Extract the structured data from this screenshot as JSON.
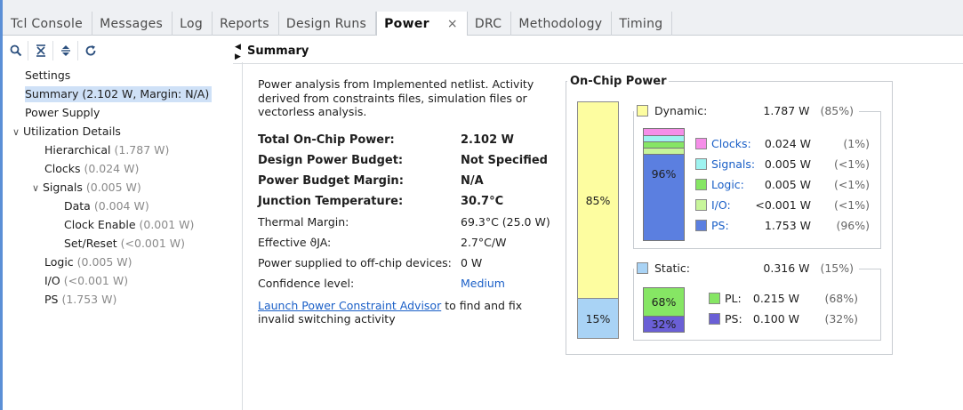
{
  "tabs": [
    {
      "label": "Tcl Console"
    },
    {
      "label": "Messages"
    },
    {
      "label": "Log"
    },
    {
      "label": "Reports"
    },
    {
      "label": "Design Runs"
    },
    {
      "label": "Power",
      "close": "×"
    },
    {
      "label": "DRC"
    },
    {
      "label": "Methodology"
    },
    {
      "label": "Timing"
    }
  ],
  "toolbar": {
    "icons": [
      "search-icon",
      "collapse-all-icon",
      "expand-all-icon",
      "refresh-icon"
    ]
  },
  "tree": {
    "settings": "Settings",
    "summary": "Summary (2.102 W, Margin: N/A)",
    "power_supply": "Power Supply",
    "utilization": "Utilization Details",
    "hierarchical": {
      "label": "Hierarchical",
      "value": "(1.787 W)"
    },
    "clocks": {
      "label": "Clocks",
      "value": "(0.024 W)"
    },
    "signals": {
      "label": "Signals",
      "value": "(0.005 W)"
    },
    "data": {
      "label": "Data",
      "value": "(0.004 W)"
    },
    "clock_enable": {
      "label": "Clock Enable",
      "value": "(0.001 W)"
    },
    "set_reset": {
      "label": "Set/Reset",
      "value": "(<0.001 W)"
    },
    "logic": {
      "label": "Logic",
      "value": "(0.005 W)"
    },
    "io": {
      "label": "I/O",
      "value": "(<0.001 W)"
    },
    "ps": {
      "label": "PS",
      "value": "(1.753 W)"
    }
  },
  "header": {
    "title": "Summary"
  },
  "summary": {
    "description": "Power analysis from Implemented netlist. Activity derived from constraints files, simulation files or vectorless analysis.",
    "rows": [
      {
        "k": "Total On-Chip Power:",
        "v": "2.102 W"
      },
      {
        "k": "Design Power Budget:",
        "v": "Not Specified"
      },
      {
        "k": "Power Budget Margin:",
        "v": "N/A"
      },
      {
        "k": "Junction Temperature:",
        "v": "30.7°C"
      },
      {
        "k": "Thermal Margin:",
        "v": "69.3°C (25.0 W)"
      },
      {
        "k": "Effective ϑJA:",
        "v": "2.7°C/W"
      },
      {
        "k": "Power supplied to off-chip devices:",
        "v": "0 W"
      },
      {
        "k": "Confidence level:",
        "v": "Medium"
      }
    ],
    "advisor_link": "Launch Power Constraint Advisor",
    "advisor_text": " to find and fix invalid switching activity"
  },
  "onchip": {
    "title": "On-Chip Power",
    "dynamic": {
      "label": "Dynamic:",
      "watts": "1.787 W",
      "pct": "(85%)",
      "bar_pct": "85%",
      "fraction": 0.85,
      "color": "#fdfda0"
    },
    "static": {
      "label": "Static:",
      "watts": "0.316 W",
      "pct": "(15%)",
      "bar_pct": "15%",
      "fraction": 0.15,
      "color": "#a9d3f5"
    },
    "dyn_bar_pct": "96%",
    "dynamic_items": [
      {
        "name": "Clocks:",
        "watts": "0.024 W",
        "pct": "(1%)",
        "color": "#f58ee8"
      },
      {
        "name": "Signals:",
        "watts": "0.005 W",
        "pct": "(<1%)",
        "color": "#9ef3f0"
      },
      {
        "name": "Logic:",
        "watts": "0.005 W",
        "pct": "(<1%)",
        "color": "#86e664"
      },
      {
        "name": "I/O:",
        "watts": "<0.001 W",
        "pct": "(<1%)",
        "color": "#c7f59a"
      },
      {
        "name": "PS:",
        "watts": "1.753 W",
        "pct": "(96%)",
        "color": "#5b7fe0"
      }
    ],
    "static_items": [
      {
        "name": "PL:",
        "watts": "0.215 W",
        "pct": "(68%)",
        "bar_pct": "68%",
        "color": "#86e664"
      },
      {
        "name": "PS:",
        "watts": "0.100 W",
        "pct": "(32%)",
        "bar_pct": "32%",
        "color": "#6a5fd6"
      }
    ]
  }
}
